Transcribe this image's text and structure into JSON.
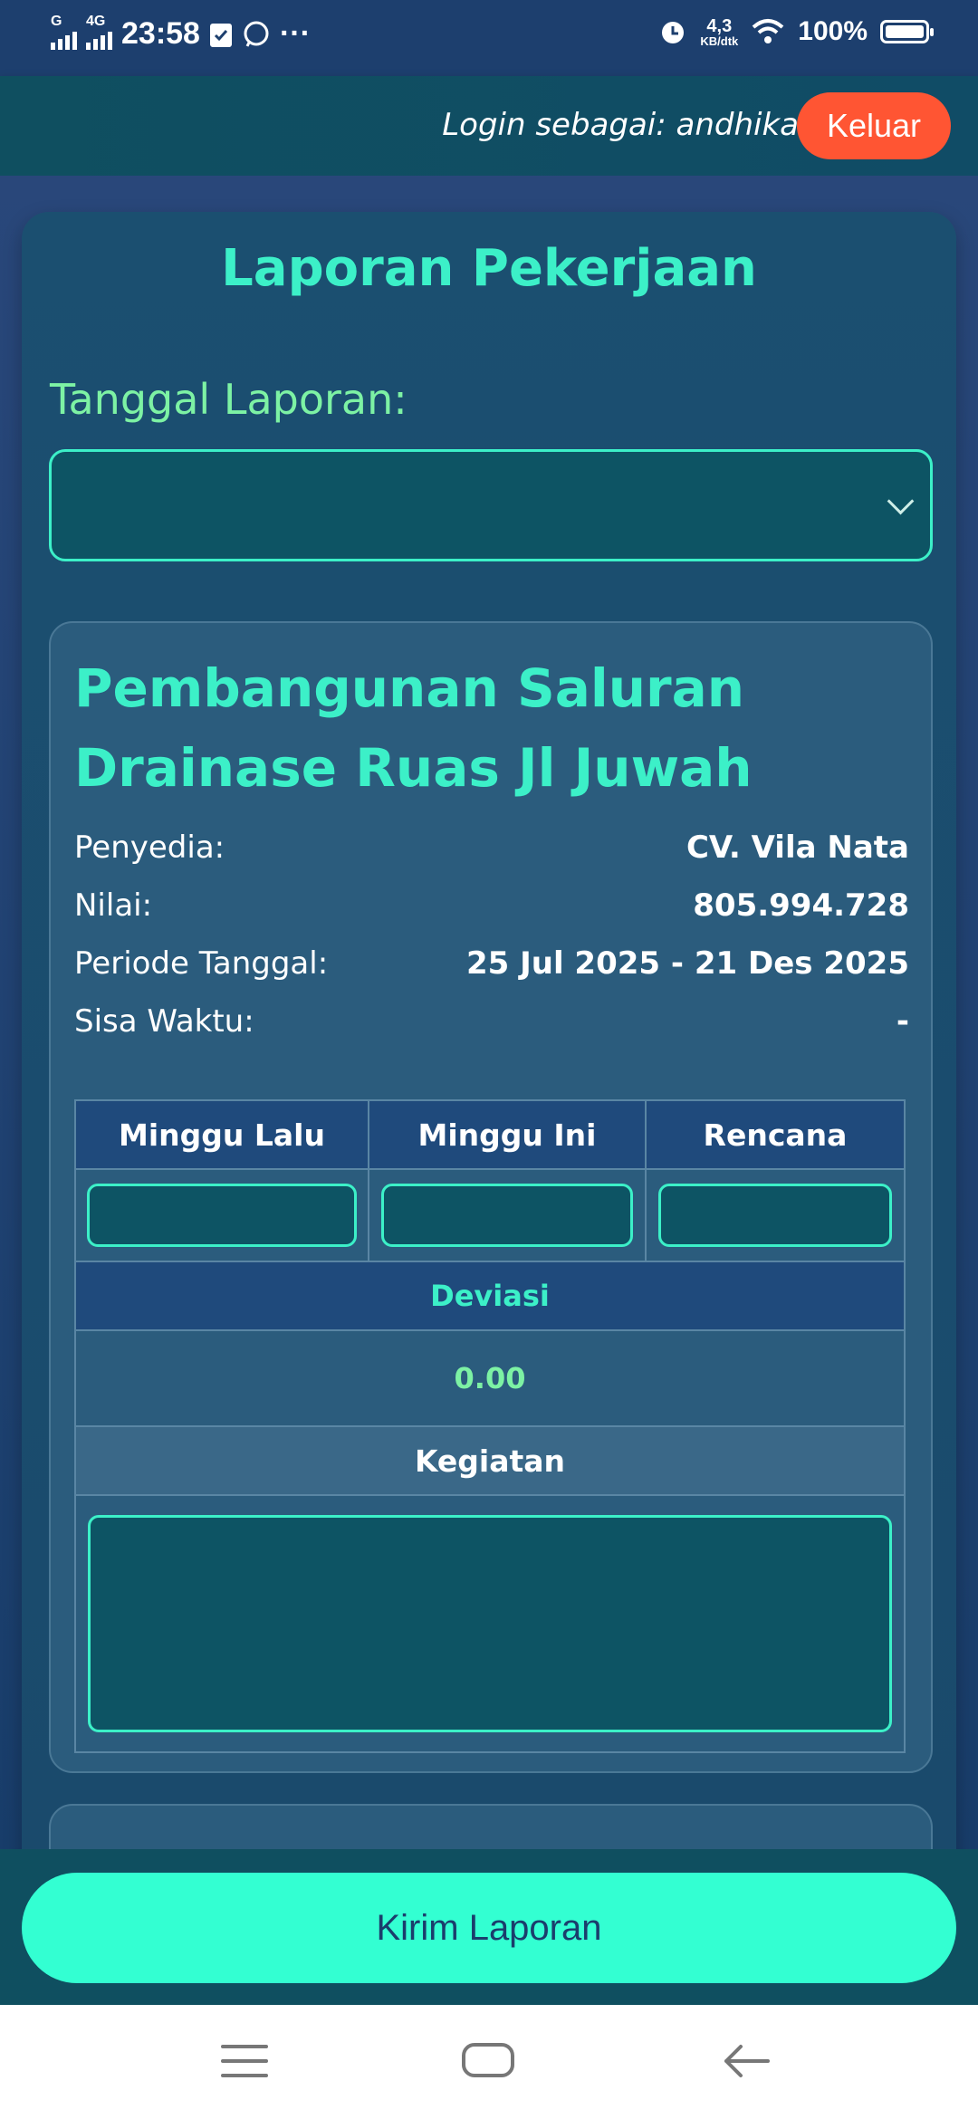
{
  "status_bar": {
    "time": "23:58",
    "net_type_1": "G",
    "net_type_2": "4G",
    "more": "···",
    "speed_value": "4,3",
    "speed_unit": "KB/dtk",
    "battery": "100%",
    "icons": [
      "signal-icon",
      "signal-4g-icon",
      "checklist-icon",
      "whatsapp-icon",
      "alarm-icon",
      "wifi-icon",
      "battery-icon"
    ]
  },
  "header": {
    "login_text": "Login sebagai: andhika",
    "logout_label": "Keluar",
    "logout_color": "#ff5533"
  },
  "page": {
    "title": "Laporan Pekerjaan",
    "date_label": "Tanggal Laporan:",
    "date_value": ""
  },
  "project": {
    "title": "Pembangunan Saluran Drainase Ruas Jl Juwah",
    "details": [
      {
        "label": "Penyedia:",
        "value": "CV. Vila Nata"
      },
      {
        "label": "Nilai:",
        "value": "805.994.728"
      },
      {
        "label": "Periode Tanggal:",
        "value": "25 Jul 2025 - 21 Des 2025"
      },
      {
        "label": "Sisa Waktu:",
        "value": "-"
      }
    ],
    "table": {
      "headers": [
        "Minggu Lalu",
        "Minggu Ini",
        "Rencana"
      ],
      "inputs": [
        "",
        "",
        ""
      ],
      "deviasi_label": "Deviasi",
      "deviasi_value": "0.00",
      "kegiatan_label": "Kegiatan",
      "kegiatan_value": ""
    }
  },
  "footer": {
    "submit_label": "Kirim Laporan",
    "accent": "#33ffd2"
  },
  "colors": {
    "accent_teal": "#3cf0c8",
    "accent_green": "#7df2a4",
    "card_bg": "#2b5c7d"
  }
}
